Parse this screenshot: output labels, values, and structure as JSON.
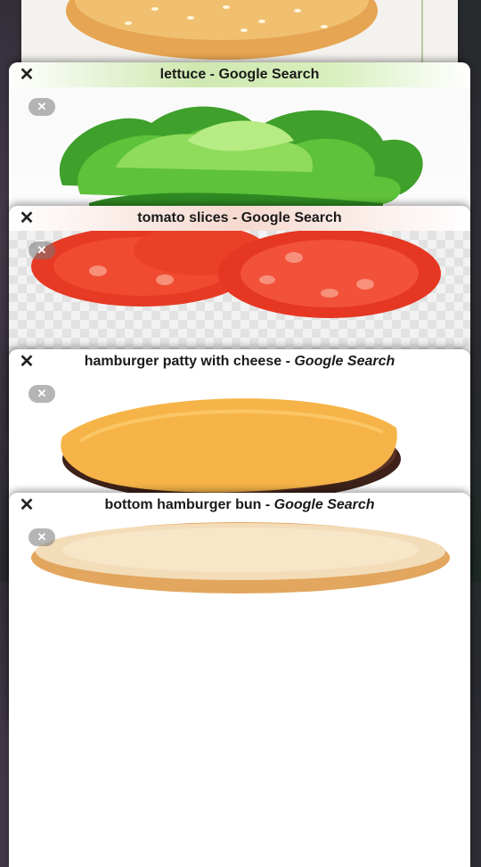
{
  "tabs": [
    {
      "id": "bun-top",
      "title": "",
      "suffix": ""
    },
    {
      "id": "lettuce",
      "title": "lettuce",
      "suffix": "Google Search",
      "sep": " - "
    },
    {
      "id": "tomato",
      "title": "tomato slices",
      "suffix": "Google Search",
      "sep": " - "
    },
    {
      "id": "patty",
      "title": "hamburger patty with cheese",
      "suffix": "Google Search",
      "sep": " - "
    },
    {
      "id": "bun-bottom",
      "title": "bottom hamburger bun",
      "suffix": "Google Search",
      "sep": " - "
    }
  ],
  "close_icon": "close-icon",
  "colors": {
    "lettuce_header": "#cfe8b0",
    "tomato_header": "#f6d9cf",
    "tomato": "#e23a22",
    "cheese": "#f4b445",
    "patty": "#4a2a20",
    "bun": "#e8b46a"
  }
}
